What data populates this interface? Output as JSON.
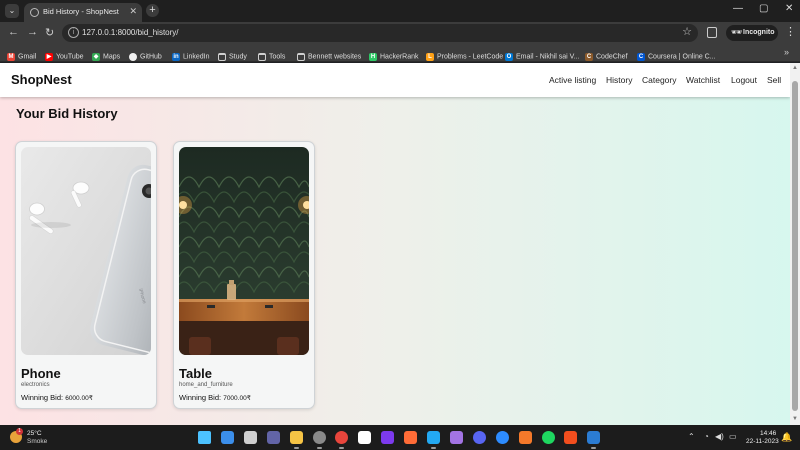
{
  "browser": {
    "tab": {
      "title": "Bid History - ShopNest",
      "close_glyph": "✕"
    },
    "tab_list_glyph": "⌄",
    "new_tab_glyph": "+",
    "window_controls": {
      "minimize": "—",
      "maximize": "▢",
      "close": "✕"
    },
    "nav": {
      "back": "←",
      "forward": "→",
      "reload": "↻"
    },
    "url": "127.0.0.1:8000/bid_history/",
    "bookmark_star": "☆",
    "incognito_label": "Incognito",
    "bookmarks": [
      {
        "label": "Gmail",
        "icon": "gmail-icon",
        "color": "#ea4335",
        "glyph": "M"
      },
      {
        "label": "YouTube",
        "icon": "youtube-icon",
        "color": "#ff0000",
        "glyph": "▶"
      },
      {
        "label": "Maps",
        "icon": "maps-icon",
        "color": "#34a853",
        "glyph": "◆"
      },
      {
        "label": "GitHub",
        "icon": "github-icon",
        "color": "#f0f0f0",
        "glyph": ""
      },
      {
        "label": "LinkedIn",
        "icon": "linkedin-icon",
        "color": "#0a66c2",
        "glyph": "in"
      },
      {
        "label": "Study",
        "icon": "folder-icon",
        "color": "folder",
        "glyph": ""
      },
      {
        "label": "Tools",
        "icon": "folder-icon",
        "color": "folder",
        "glyph": ""
      },
      {
        "label": "Bennett websites",
        "icon": "folder-icon",
        "color": "folder",
        "glyph": ""
      },
      {
        "label": "HackerRank",
        "icon": "hackerrank-icon",
        "color": "#2ec866",
        "glyph": "H"
      },
      {
        "label": "Problems - LeetCode",
        "icon": "leetcode-icon",
        "color": "#ffa116",
        "glyph": "L"
      },
      {
        "label": "Email - Nikhil sai V...",
        "icon": "outlook-icon",
        "color": "#0078d4",
        "glyph": "O"
      },
      {
        "label": "CodeChef",
        "icon": "codechef-icon",
        "color": "#8b5a2b",
        "glyph": "C"
      },
      {
        "label": "Coursera | Online C...",
        "icon": "coursera-icon",
        "color": "#0056d2",
        "glyph": "C"
      }
    ],
    "bookmarks_more": "»"
  },
  "site": {
    "brand": "ShopNest",
    "nav_links": [
      "Active listing",
      "History",
      "Category",
      "Watchlist",
      "Logout",
      "Sell"
    ]
  },
  "page": {
    "title": "Your Bid History",
    "winning_bid_label": "Winning Bid:",
    "cards": [
      {
        "name": "Phone",
        "category": "electronics",
        "amount": "6000.00₹",
        "image": "phone-earbuds-photo"
      },
      {
        "name": "Table",
        "category": "home_and_furniture",
        "amount": "7000.00₹",
        "image": "wooden-table-photo"
      }
    ]
  },
  "taskbar": {
    "weather": {
      "temp": "25°C",
      "condition": "Smoke",
      "badge": "1"
    },
    "apps": [
      {
        "name": "windows-start-icon",
        "color": "#4cc2ff"
      },
      {
        "name": "copilot-icon",
        "color": "#3b8eea"
      },
      {
        "name": "task-view-icon",
        "color": "#cfcfcf"
      },
      {
        "name": "teams-icon",
        "color": "#6264a7"
      },
      {
        "name": "file-explorer-icon",
        "color": "#f6c445"
      },
      {
        "name": "chrome-incognito-icon",
        "color": "#8a8a8a"
      },
      {
        "name": "chrome-icon",
        "color": "#e8453c"
      },
      {
        "name": "notion-icon",
        "color": "#ffffff"
      },
      {
        "name": "obsidian-icon",
        "color": "#7c3aed"
      },
      {
        "name": "postman-icon",
        "color": "#ff6c37"
      },
      {
        "name": "vscode-icon",
        "color": "#23a9f2"
      },
      {
        "name": "visual-studio-icon",
        "color": "#a374e4"
      },
      {
        "name": "discord-icon",
        "color": "#5865f2"
      },
      {
        "name": "zoom-icon",
        "color": "#2d8cff"
      },
      {
        "name": "blender-icon",
        "color": "#f5792a"
      },
      {
        "name": "spotify-icon",
        "color": "#1ed760"
      },
      {
        "name": "figma-icon",
        "color": "#f24e1e"
      },
      {
        "name": "word-icon",
        "color": "#2b7cd3"
      }
    ],
    "tray": {
      "chevron": "⌃",
      "wifi": "◔",
      "volume": "◀)",
      "battery": "▭"
    },
    "clock": {
      "time": "14:46",
      "date": "22-11-2023"
    },
    "notification_glyph": "🔔"
  }
}
